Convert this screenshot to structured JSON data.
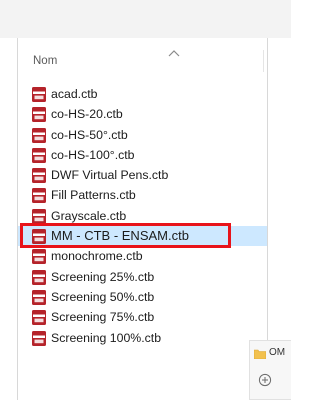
{
  "header": {
    "column_label": "Nom"
  },
  "files": [
    {
      "name": "acad.ctb",
      "icon": "ctb-file-icon"
    },
    {
      "name": "co-HS-20.ctb",
      "icon": "ctb-file-icon"
    },
    {
      "name": "co-HS-50°.ctb",
      "icon": "ctb-file-icon"
    },
    {
      "name": "co-HS-100°.ctb",
      "icon": "ctb-file-icon"
    },
    {
      "name": "DWF Virtual Pens.ctb",
      "icon": "ctb-file-icon"
    },
    {
      "name": "Fill Patterns.ctb",
      "icon": "ctb-file-icon"
    },
    {
      "name": "Grayscale.ctb",
      "icon": "ctb-file-icon"
    },
    {
      "name": "MM - CTB - ENSAM.ctb",
      "icon": "ctb-file-icon",
      "selected": true
    },
    {
      "name": "monochrome.ctb",
      "icon": "ctb-file-icon"
    },
    {
      "name": "Screening 25%.ctb",
      "icon": "ctb-file-icon"
    },
    {
      "name": "Screening 50%.ctb",
      "icon": "ctb-file-icon"
    },
    {
      "name": "Screening 75%.ctb",
      "icon": "ctb-file-icon"
    },
    {
      "name": "Screening 100%.ctb",
      "icon": "ctb-file-icon"
    }
  ],
  "popup": {
    "label": "OM"
  },
  "colors": {
    "selection_bg": "#cde8ff",
    "highlight_border": "#e8131a",
    "icon_red": "#b5232a"
  }
}
